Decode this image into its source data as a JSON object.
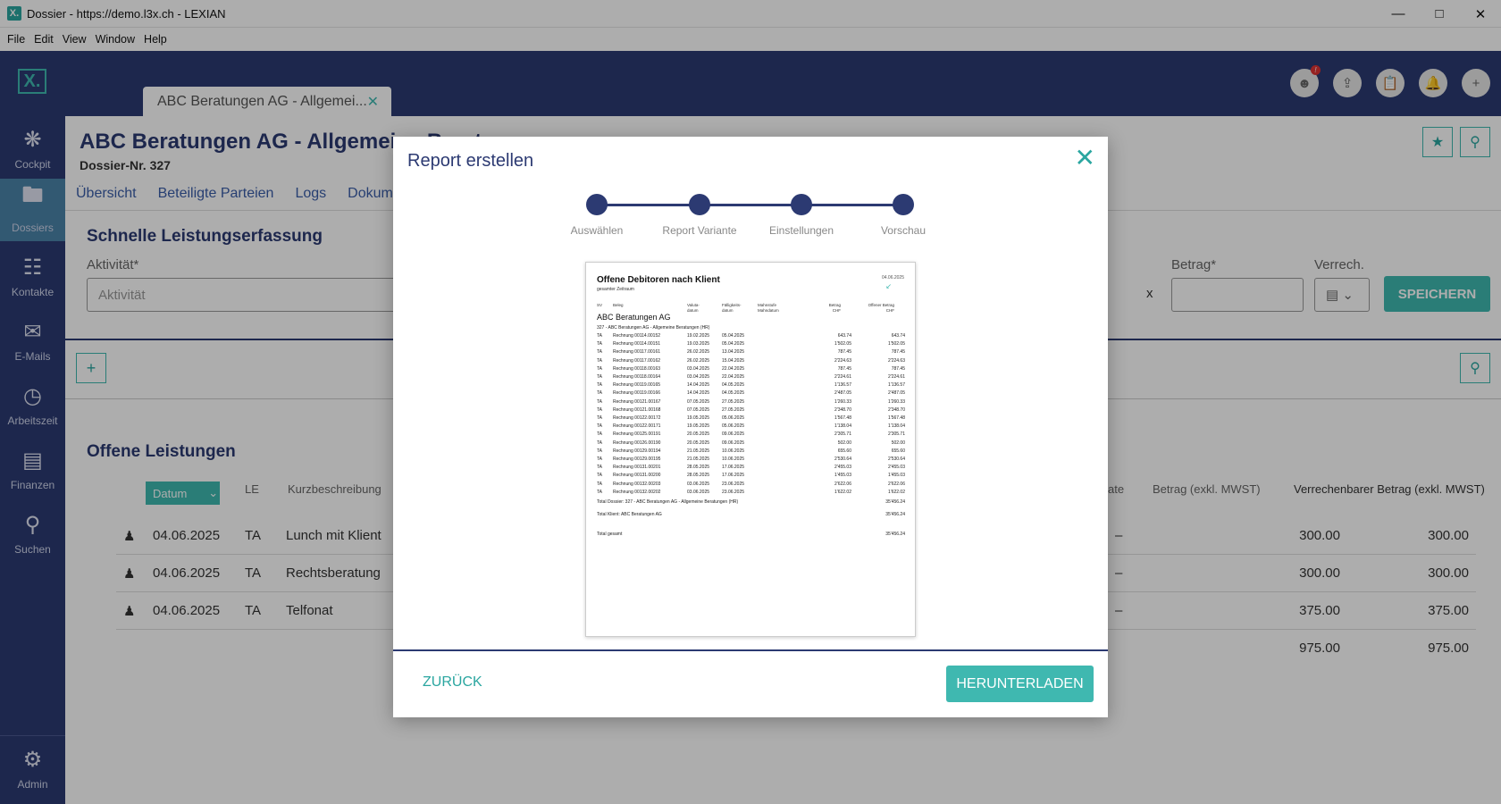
{
  "window": {
    "title": "Dossier - https://demo.l3x.ch - LEXIAN",
    "logo": "X."
  },
  "menu": [
    "File",
    "Edit",
    "View",
    "Window",
    "Help"
  ],
  "sidebar": {
    "logo": "X.",
    "items": [
      {
        "label": "Cockpit",
        "icon": "network-icon"
      },
      {
        "label": "Dossiers",
        "icon": "folder-icon"
      },
      {
        "label": "Kontakte",
        "icon": "contact-card-icon"
      },
      {
        "label": "E-Mails",
        "icon": "mail-icon"
      },
      {
        "label": "Arbeitszeit",
        "icon": "clock-icon"
      },
      {
        "label": "Finanzen",
        "icon": "invoice-icon"
      },
      {
        "label": "Suchen",
        "icon": "search-icon"
      },
      {
        "label": "Admin",
        "icon": "gear-icon"
      }
    ]
  },
  "tab": {
    "label": "ABC Beratungen AG - Allgemei..."
  },
  "header": {
    "title": "ABC Beratungen AG - Allgemeine Berat",
    "subtitle": "Dossier-Nr. 327",
    "badge": "!"
  },
  "navtabs": [
    "Übersicht",
    "Beteiligte Parteien",
    "Logs",
    "Dokume"
  ],
  "quick": {
    "title": "Schnelle Leistungserfassung",
    "activity_label": "Aktivität*",
    "activity_placeholder": "Aktivität",
    "amount_label": "Betrag*",
    "verrech_label": "Verrech.",
    "x_label": "x",
    "save": "SPEICHERN"
  },
  "open": {
    "title": "Offene Leistungen",
    "headers": {
      "datum": "Datum",
      "le": "LE",
      "kurz": "Kurzbeschreibung",
      "rate": "ate",
      "betrag": "Betrag (exkl. MWST)",
      "verrechenbar": "Verrechenbarer Betrag (exkl. MWST)"
    },
    "rows": [
      {
        "date": "04.06.2025",
        "le": "TA",
        "desc": "Lunch mit Klient",
        "dash": "–",
        "betrag": "300.00",
        "verrech": "300.00"
      },
      {
        "date": "04.06.2025",
        "le": "TA",
        "desc": "Rechtsberatung",
        "dash": "–",
        "betrag": "300.00",
        "verrech": "300.00"
      },
      {
        "date": "04.06.2025",
        "le": "TA",
        "desc": "Telfonat",
        "dash": "–",
        "betrag": "375.00",
        "verrech": "375.00"
      }
    ],
    "total_betrag": "975.00",
    "total_verrech": "975.00"
  },
  "modal": {
    "title": "Report erstellen",
    "steps": [
      "Auswählen",
      "Report Variante",
      "Einstellungen",
      "Vorschau"
    ],
    "back": "ZURÜCK",
    "download": "HERUNTERLADEN",
    "preview": {
      "title": "Offene Debitoren nach Klient",
      "subtitle": "gesamter Zeitraum",
      "date": "04.06.2025",
      "cols": [
        "SV",
        "Beleg",
        "Valuta-\ndatum",
        "Fälligkeits-\ndatum",
        "Mahnstufe\nMahndatum",
        "Betrag\nCHF",
        "Offener Betrag\nCHF"
      ],
      "client": "ABC Beratungen AG",
      "group": "327 - ABC Beratungen AG - Allgemeine Beratungen (HR)",
      "rows": [
        [
          "TA",
          "Rechnung 00114.00152",
          "19.02.2025",
          "05.04.2025",
          "643.74",
          "643.74"
        ],
        [
          "TA",
          "Rechnung 00114.00151",
          "19.03.2025",
          "05.04.2025",
          "1'502.05",
          "1'502.05"
        ],
        [
          "TA",
          "Rechnung 00117.00161",
          "26.02.2025",
          "13.04.2025",
          "787.45",
          "787.45"
        ],
        [
          "TA",
          "Rechnung 00117.00162",
          "26.02.2025",
          "15.04.2025",
          "2'224.63",
          "2'224.63"
        ],
        [
          "TA",
          "Rechnung 00118.00163",
          "03.04.2025",
          "22.04.2025",
          "787.45",
          "787.45"
        ],
        [
          "TA",
          "Rechnung 00118.00164",
          "03.04.2025",
          "22.04.2025",
          "2'224.61",
          "2'224.61"
        ],
        [
          "TA",
          "Rechnung 00119.00165",
          "14.04.2025",
          "04.05.2025",
          "1'136.57",
          "1'136.57"
        ],
        [
          "TA",
          "Rechnung 00119.00166",
          "14.04.2025",
          "04.05.2025",
          "2'487.05",
          "2'487.05"
        ],
        [
          "TA",
          "Rechnung 00121.00167",
          "07.05.2025",
          "27.05.2025",
          "1'260.33",
          "1'260.33"
        ],
        [
          "TA",
          "Rechnung 00121.00168",
          "07.05.2025",
          "27.05.2025",
          "2'348.70",
          "2'348.70"
        ],
        [
          "TA",
          "Rechnung 00122.00172",
          "19.05.2025",
          "05.06.2025",
          "1'567.48",
          "1'567.48"
        ],
        [
          "TA",
          "Rechnung 00122.00171",
          "19.05.2025",
          "05.06.2025",
          "1'138.04",
          "1'138.04"
        ],
        [
          "TA",
          "Rechnung 00125.00191",
          "20.05.2025",
          "09.06.2025",
          "2'305.71",
          "2'305.71"
        ],
        [
          "TA",
          "Rechnung 00126.00190",
          "20.05.2025",
          "09.06.2025",
          "502.00",
          "502.00"
        ],
        [
          "TA",
          "Rechnung 00129.00194",
          "21.05.2025",
          "10.06.2025",
          "655.60",
          "655.60"
        ],
        [
          "TA",
          "Rechnung 00129.00195",
          "21.05.2025",
          "10.06.2025",
          "2'530.64",
          "2'530.64"
        ],
        [
          "TA",
          "Rechnung 00131.00201",
          "28.05.2025",
          "17.06.2025",
          "2'455.03",
          "2'455.03"
        ],
        [
          "TA",
          "Rechnung 00131.00200",
          "28.05.2025",
          "17.06.2025",
          "1'455.03",
          "1'455.03"
        ],
        [
          "TA",
          "Rechnung 00132.00203",
          "03.06.2025",
          "23.06.2025",
          "2'622.06",
          "2'622.06"
        ],
        [
          "TA",
          "Rechnung 00132.00202",
          "03.06.2025",
          "23.06.2025",
          "1'622.02",
          "1'622.02"
        ]
      ],
      "total_dossier_label": "Total Dossier: 327 - ABC Beratungen AG - Allgemeine Beratungen (HR)",
      "total_dossier": "35'456.24",
      "total_client_label": "Total Klient: ABC Beratungen AG",
      "total_client": "35'456.24",
      "total_label": "Total gesamt",
      "total": "35'456.24"
    }
  }
}
